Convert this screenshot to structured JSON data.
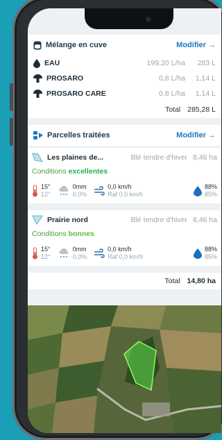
{
  "tank": {
    "title": "Mélange en cuve",
    "action": "Modifier",
    "products": [
      {
        "name": "EAU",
        "rate": "199,20 L/ha",
        "total": "283 L"
      },
      {
        "name": "PROSARO",
        "rate": "0,8 L/ha",
        "total": "1,14 L"
      },
      {
        "name": "PROSARO CARE",
        "rate": "0,8 L/ha",
        "total": "1,14 L"
      }
    ],
    "total_label": "Total",
    "total_value": "285,28 L"
  },
  "parcels": {
    "title": "Parcelles traitées",
    "action": "Modifier",
    "items": [
      {
        "name": "Les plaines de...",
        "crop": "Blé tendre d'hiver",
        "area": "8,46 ha",
        "conditions_label": "Conditions",
        "conditions_value": "excellentes",
        "temp_high": "15°",
        "temp_low": "12°",
        "rain": "0mm",
        "rain_prob": "0,0%",
        "wind": "0,0 km/h",
        "gust": "Raf 0,0 km/h",
        "humidity": "88%",
        "humidity_low": "85%"
      },
      {
        "name": "Prairie nord",
        "crop": "Blé tendre d'hiver",
        "area": "8,46 ha",
        "conditions_label": "Conditions",
        "conditions_value": "bonnes",
        "temp_high": "15°",
        "temp_low": "12°",
        "rain": "0mm",
        "rain_prob": "0,0%",
        "wind": "0,0 km/h",
        "gust": "Raf 0,0 km/h",
        "humidity": "88%",
        "humidity_low": "85%"
      }
    ],
    "total_label": "Total",
    "total_value": "14,80 ha"
  },
  "colors": {
    "accent": "#1a78c2",
    "excellent": "#1fb34a",
    "good": "#58bf3a",
    "background": "#1a9fb6"
  },
  "icons": [
    "tank-icon",
    "drop-icon",
    "mushroom-icon",
    "parcels-icon",
    "field-shape-icon",
    "thermometer-icon",
    "cloud-rain-icon",
    "wind-icon",
    "humidity-drop-icon",
    "arrow-right-icon"
  ]
}
